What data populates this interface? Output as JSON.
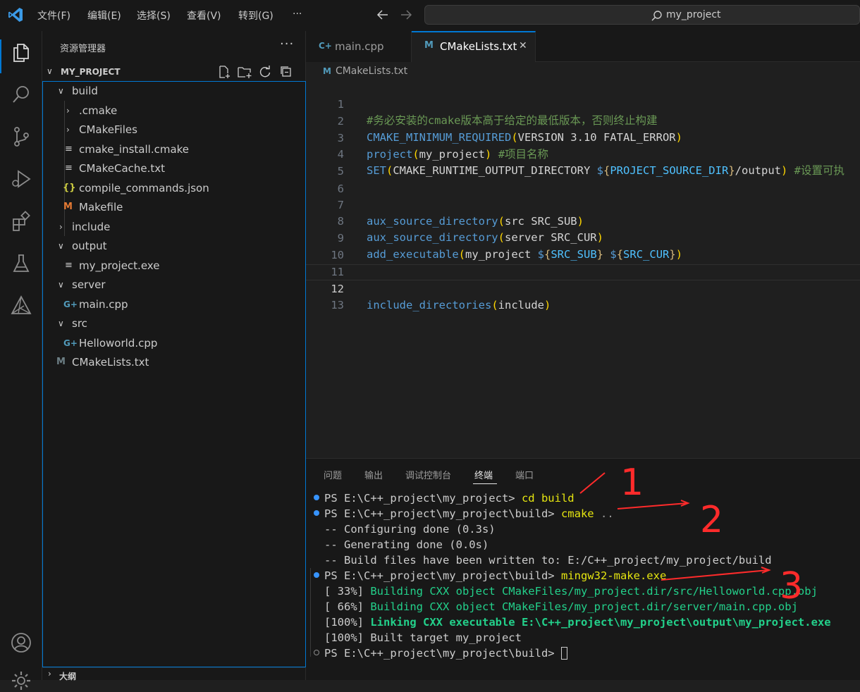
{
  "menu": [
    "文件(F)",
    "编辑(E)",
    "选择(S)",
    "查看(V)",
    "转到(G)",
    "···"
  ],
  "command_center": {
    "text": "my_project"
  },
  "sidebar": {
    "title": "资源管理器",
    "more": "···",
    "project_name": "MY_PROJECT",
    "outline_label": "大纲",
    "tree": [
      {
        "label": "build",
        "kind": "folder-open"
      },
      {
        "label": ".cmake",
        "kind": "folder-closed"
      },
      {
        "label": "CMakeFiles",
        "kind": "folder-closed"
      },
      {
        "label": "cmake_install.cmake",
        "kind": "file-lines"
      },
      {
        "label": "CMakeCache.txt",
        "kind": "file-lines"
      },
      {
        "label": "compile_commands.json",
        "kind": "json"
      },
      {
        "label": "Makefile",
        "kind": "makefile"
      },
      {
        "label": "include",
        "kind": "folder-closed"
      },
      {
        "label": "output",
        "kind": "folder-open"
      },
      {
        "label": "my_project.exe",
        "kind": "file-lines"
      },
      {
        "label": "server",
        "kind": "folder-open"
      },
      {
        "label": "main.cpp",
        "kind": "cpp"
      },
      {
        "label": "src",
        "kind": "folder-open"
      },
      {
        "label": "Helloworld.cpp",
        "kind": "cpp"
      },
      {
        "label": "CMakeLists.txt",
        "kind": "cmake"
      }
    ]
  },
  "tabs": [
    {
      "label": "main.cpp",
      "icon": "C+"
    },
    {
      "label": "CMakeLists.txt",
      "icon": "M",
      "close": "✕"
    }
  ],
  "breadcrumb": "CMakeLists.txt",
  "code": {
    "line_numbers": [
      "1",
      "2",
      "3",
      "4",
      "5",
      "6",
      "7",
      "8",
      "9",
      "10",
      "11",
      "12",
      "13"
    ],
    "l1": "#务必安装的cmake版本高于给定的最低版本，否则终止构建",
    "l2_kw": "CMAKE_MINIMUM_REQUIRED",
    "l2_args": "VERSION 3.10 FATAL_ERROR",
    "l3_kw": "project",
    "l3_args": "my_project",
    "l3_com": "#项目名称",
    "l4_kw": "SET",
    "l4_a": "CMAKE_RUNTIME_OUTPUT_DIRECTORY ",
    "l4_var": "PROJECT_SOURCE_DIR",
    "l4_b": "/output",
    "l4_com": "#设置可执",
    "l7_kw": "aux_source_directory",
    "l7_args": "src SRC_SUB",
    "l8_kw": "aux_source_directory",
    "l8_args": "server SRC_CUR",
    "l9_kw": "add_executable",
    "l9_a": "my_project ",
    "l9_var1": "SRC_SUB",
    "l9_var2": "SRC_CUR",
    "l12_kw": "include_directories",
    "l12_args": "include"
  },
  "panel": {
    "tabs": [
      "问题",
      "输出",
      "调试控制台",
      "终端",
      "端口"
    ],
    "active_tab": "终端",
    "terminal": {
      "prompt_build": "PS E:\\C++_project\\my_project>",
      "cmd1": "cd build",
      "prompt_in_build": "PS E:\\C++_project\\my_project\\build>",
      "cmd2": "cmake",
      "cmd2_arg": "..",
      "out1": "-- Configuring done (0.3s)",
      "out2": "-- Generating done (0.0s)",
      "out3": "-- Build files have been written to: E:/C++_project/my_project/build",
      "cmd3": "mingw32-make.exe",
      "b1_pct": "[ 33%]",
      "b1_text": "Building CXX object CMakeFiles/my_project.dir/src/Helloworld.cpp.obj",
      "b2_pct": "[ 66%]",
      "b2_text": "Building CXX object CMakeFiles/my_project.dir/server/main.cpp.obj",
      "b3_pct": "[100%]",
      "b3_text": "Linking CXX executable E:\\C++_project\\my_project\\output\\my_project.exe",
      "b4": "[100%] Built target my_project"
    }
  },
  "annotations": [
    "1",
    "2",
    "3"
  ],
  "colors": {
    "accent": "#0078d4",
    "annotation": "#ff2b2b",
    "terminal_green": "#23d18b",
    "terminal_yellow": "#e5e510"
  }
}
